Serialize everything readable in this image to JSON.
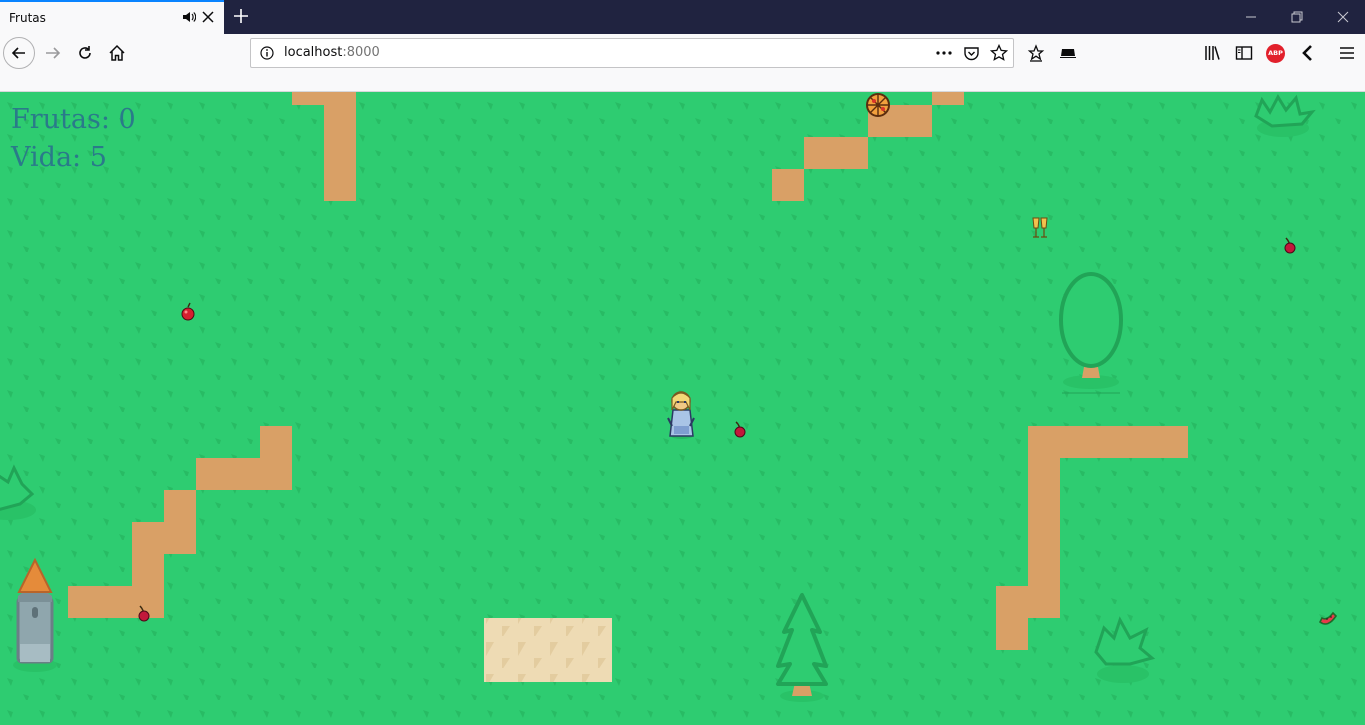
{
  "browser": {
    "tab_title": "Frutas",
    "url_host": "localhost",
    "url_port": ":8000",
    "abp_label": "ABP"
  },
  "hud": {
    "frutas_label": "Frutas:",
    "frutas_value": "0",
    "vida_label": "Vida:",
    "vida_value": "5"
  },
  "game": {
    "colors": {
      "grass": "#2ecc71",
      "grass_mark": "#27b862",
      "dirt": "#d9a066",
      "sand": "#eedbb4",
      "hud_text": "#2a7a8a",
      "tree_outline": "#1e8f4e"
    },
    "items": [
      {
        "type": "pizza-icon"
      },
      {
        "type": "champagne-icon"
      },
      {
        "type": "cherry-icon"
      },
      {
        "type": "apple-icon"
      },
      {
        "type": "cherry-icon"
      },
      {
        "type": "cherry-icon"
      },
      {
        "type": "watermelon-icon"
      }
    ],
    "player": {
      "type": "blonde-girl-character"
    },
    "decorations": [
      "round-tree",
      "pine-tree",
      "bush",
      "tower"
    ]
  }
}
